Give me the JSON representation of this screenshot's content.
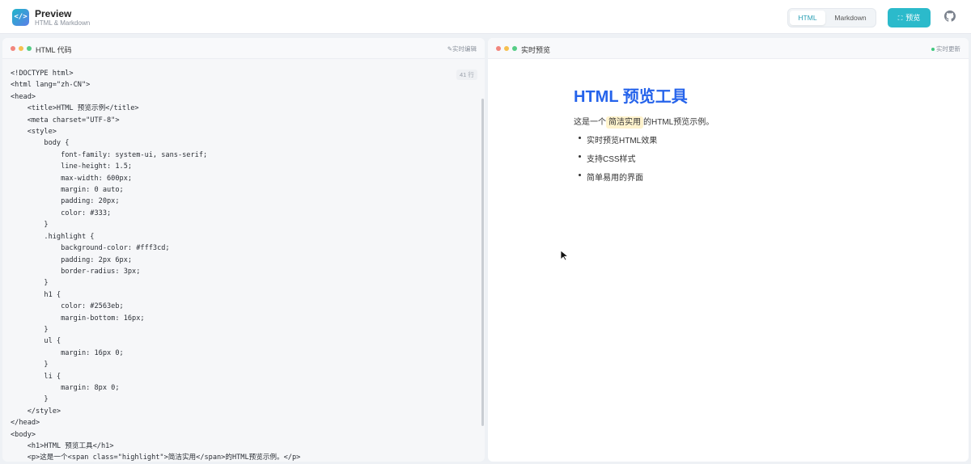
{
  "app": {
    "logo_glyph": "</>",
    "title": "Preview",
    "subtitle": "HTML & Markdown"
  },
  "modes": {
    "html": "HTML",
    "markdown": "Markdown",
    "selected": "HTML"
  },
  "actions": {
    "preview_label": "预览",
    "preview_icon": "expand-icon",
    "github_icon": "github-icon"
  },
  "editor": {
    "title": "HTML 代码",
    "tag": "实时编辑",
    "line_count": "41 行",
    "code": "<!DOCTYPE html>\n<html lang=\"zh-CN\">\n<head>\n    <title>HTML 预览示例</title>\n    <meta charset=\"UTF-8\">\n    <style>\n        body {\n            font-family: system-ui, sans-serif;\n            line-height: 1.5;\n            max-width: 600px;\n            margin: 0 auto;\n            padding: 20px;\n            color: #333;\n        }\n        .highlight {\n            background-color: #fff3cd;\n            padding: 2px 6px;\n            border-radius: 3px;\n        }\n        h1 {\n            color: #2563eb;\n            margin-bottom: 16px;\n        }\n        ul {\n            margin: 16px 0;\n        }\n        li {\n            margin: 8px 0;\n        }\n    </style>\n</head>\n<body>\n    <h1>HTML 预览工具</h1>\n    <p>这是一个<span class=\"highlight\">简洁实用</span>的HTML预览示例。</p>"
  },
  "preview": {
    "title": "实时预览",
    "tag": "实时更新",
    "doc": {
      "heading": "HTML 预览工具",
      "para_before": "这是一个",
      "para_highlight": "简洁实用",
      "para_after": "的HTML预览示例。",
      "items": [
        "实时预览HTML效果",
        "支持CSS样式",
        "简单易用的界面"
      ]
    }
  },
  "colors": {
    "accent": "#2bbacb",
    "heading": "#2563eb",
    "highlight": "#fff3cd"
  }
}
